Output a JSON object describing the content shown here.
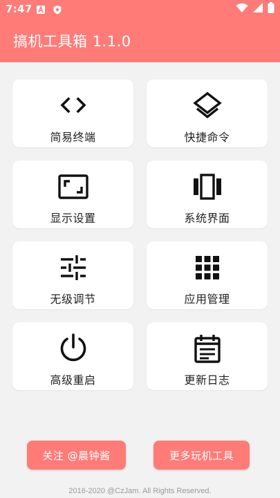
{
  "status_bar": {
    "time": "7:47",
    "left_icons": [
      "a-notification-icon",
      "shield-notification-icon"
    ],
    "right_icons": [
      "wifi-icon",
      "signal-icon",
      "battery-icon"
    ]
  },
  "app_bar": {
    "title": "搞机工具箱 1.1.0"
  },
  "grid": [
    {
      "label": "简易终端",
      "icon": "code-brackets-icon"
    },
    {
      "label": "快捷命令",
      "icon": "layers-icon"
    },
    {
      "label": "显示设置",
      "icon": "aspect-ratio-icon"
    },
    {
      "label": "系统界面",
      "icon": "view-carousel-icon"
    },
    {
      "label": "无级调节",
      "icon": "tune-sliders-icon"
    },
    {
      "label": "应用管理",
      "icon": "apps-grid-icon"
    },
    {
      "label": "高级重启",
      "icon": "power-icon"
    },
    {
      "label": "更新日志",
      "icon": "calendar-log-icon"
    }
  ],
  "buttons": {
    "follow": "关注 @晨钟酱",
    "more_tools": "更多玩机工具"
  },
  "footer": "2016-2020 @CzJam. All Rights Reserved.",
  "colors": {
    "accent": "#ff7b78",
    "background": "#f2f2f2",
    "card": "#ffffff",
    "text": "#222222"
  }
}
